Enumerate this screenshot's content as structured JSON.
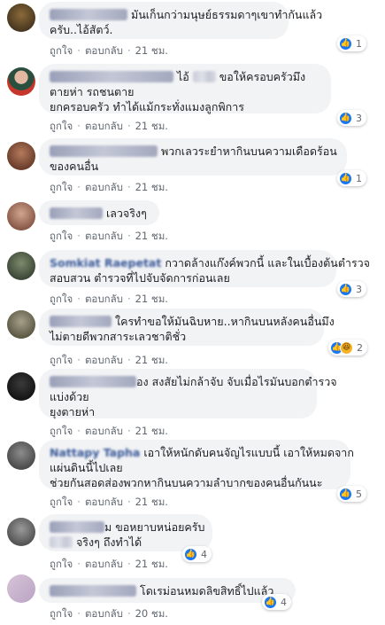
{
  "action_labels": {
    "like": "ถูกใจ",
    "reply": "ตอบกลับ"
  },
  "comments": [
    {
      "lines": [
        "มันเก็นกว่ามนุษย์ธรรมดาๆเขาทำกันแล้ว",
        "ครับ..ไอ้สัตว์."
      ],
      "time": "21 ชม.",
      "reactions": "1",
      "icons": [
        "like-icon"
      ]
    },
    {
      "lines": [
        "ไอ้",
        "ขอให้ครอบครัวมึง",
        "ตายห่า รถชนตาย",
        "ยกครอบครัว ทำได้แม้กระทั่งแมงลูกพิการ"
      ],
      "time": "21 ชม.",
      "reactions": "3",
      "icons": [
        "like-icon"
      ]
    },
    {
      "lines": [
        "พวกเลวระยำหากินบนความเดือดร้อน",
        "ของคนอื่น"
      ],
      "time": "21 ชม.",
      "reactions": "1",
      "icons": [
        "like-icon"
      ]
    },
    {
      "lines": [
        "เลวจริงๆ"
      ],
      "time": "21 ชม.",
      "reactions": "",
      "icons": []
    },
    {
      "lines": [
        "Somkiat Raepetat",
        "กวาดล้างแก๊งค์พวกนี้ และในเบื้องต้นตำรวจ",
        "สอบสวน ตำรวจที่ไปจับจัดการก่อนเลย"
      ],
      "time": "21 ชม.",
      "reactions": "3",
      "icons": [
        "like-icon"
      ]
    },
    {
      "lines": [
        "ใครทำขอให้มันฉิบหาย..หากินบนหลังคนอื่นมึง",
        "ไม่ตายดีพวกสาระเลวชาติชั่ว"
      ],
      "time": "21 ชม.",
      "reactions": "2",
      "icons": [
        "like-icon",
        "haha-icon"
      ]
    },
    {
      "lines": [
        "อง",
        "สงสัยไม่กล้าจับ จับเมื่อไรมันบอกตำรวจ",
        "แบ่งด้วย",
        "ยุงตายห่า"
      ],
      "time": "21 ชม.",
      "reactions": "",
      "icons": []
    },
    {
      "lines": [
        "Nattapy Tapha",
        "เอาให้หนักดับคนจัญไรแบบนี้ เอาให้หมดจาก",
        "แผ่นดินนี้ไปเลย",
        "ช่วยกันสอดส่องพวกหากินบนความลำบากของคนอื่นกันนะ"
      ],
      "time": "21 ชม.",
      "reactions": "5",
      "icons": [
        "like-icon"
      ]
    },
    {
      "lines": [
        "ม",
        "ขอหยาบหน่อยครับ",
        "จริงๆ ถึงทำได้"
      ],
      "time": "21 ชม.",
      "reactions": "4",
      "icons": [
        "like-icon"
      ]
    },
    {
      "lines": [
        "โดเรม่อนหมดลิขสิทธิ์ไปแล้ว"
      ],
      "time": "20 ชม.",
      "reactions": "4",
      "icons": [
        "like-icon"
      ]
    }
  ],
  "colors": {
    "bubble": "#f2f3f5",
    "like": "#1877f2",
    "haha": "#f7b125",
    "meta": "#606770"
  }
}
